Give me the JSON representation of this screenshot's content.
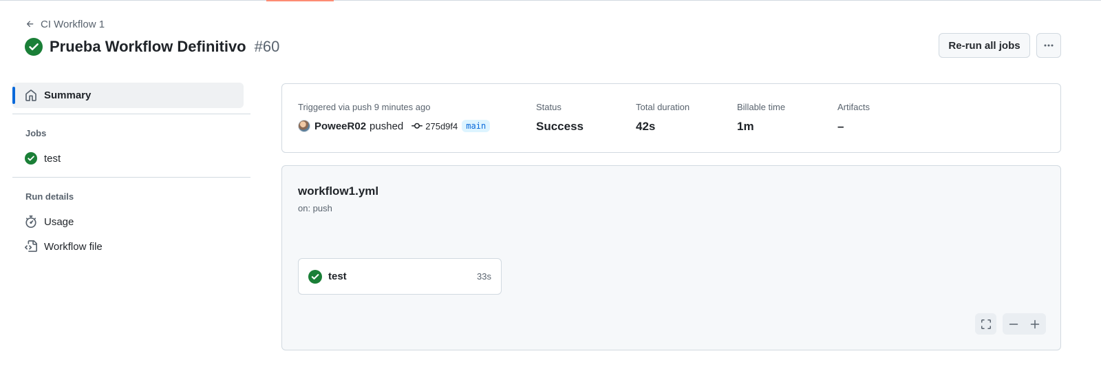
{
  "header": {
    "back_label": "CI Workflow 1",
    "title": "Prueba Workflow Definitivo",
    "run_number": "#60",
    "rerun_label": "Re-run all jobs"
  },
  "sidebar": {
    "summary_label": "Summary",
    "jobs_heading": "Jobs",
    "jobs": [
      {
        "label": "test",
        "status": "success"
      }
    ],
    "run_details_heading": "Run details",
    "usage_label": "Usage",
    "workflow_file_label": "Workflow file"
  },
  "summary": {
    "trigger_text": "Triggered via push 9 minutes ago",
    "actor": "PoweeR02",
    "action": "pushed",
    "commit": "275d9f4",
    "branch": "main",
    "status_label": "Status",
    "status_value": "Success",
    "duration_label": "Total duration",
    "duration_value": "42s",
    "billable_label": "Billable time",
    "billable_value": "1m",
    "artifacts_label": "Artifacts",
    "artifacts_value": "–"
  },
  "graph": {
    "workflow_file": "workflow1.yml",
    "trigger": "on: push",
    "job": {
      "name": "test",
      "duration": "33s",
      "status": "success"
    }
  },
  "colors": {
    "success": "#1a7f37",
    "accent": "#0969da",
    "muted": "#59636e"
  }
}
